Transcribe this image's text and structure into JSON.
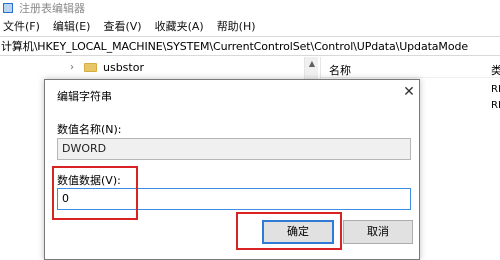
{
  "window": {
    "title": "注册表编辑器"
  },
  "menu": [
    "文件(F)",
    "编辑(E)",
    "查看(V)",
    "收藏夹(A)",
    "帮助(H)"
  ],
  "address": "计算机\\HKEY_LOCAL_MACHINE\\SYSTEM\\CurrentControlSet\\Control\\UPdata\\UpdataMode",
  "tree": {
    "items": [
      {
        "label": "usbstor"
      }
    ]
  },
  "right_pane": {
    "col_name": "名称",
    "col_type": "类",
    "fragments": [
      "RI",
      "RI"
    ]
  },
  "dialog": {
    "title": "编辑字符串",
    "name_label": "数值名称(N):",
    "name_value": "DWORD",
    "data_label": "数值数据(V):",
    "data_value": "0",
    "ok_label": "确定",
    "cancel_label": "取消",
    "close_glyph": "✕"
  },
  "colors": {
    "highlight": "#d92222",
    "focus": "#3f8ee6"
  }
}
